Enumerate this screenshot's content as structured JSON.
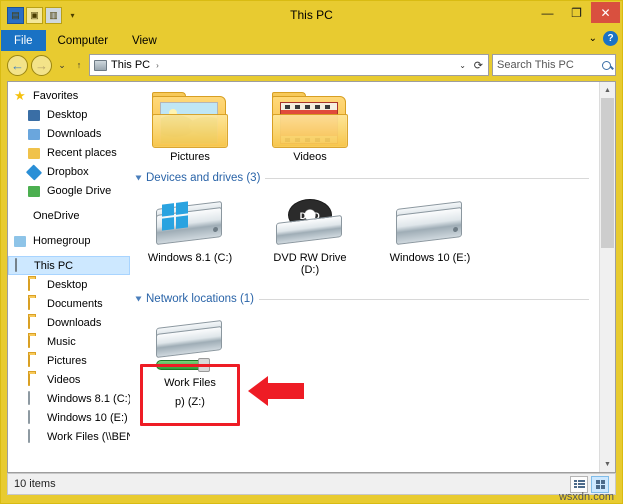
{
  "window": {
    "title": "This PC",
    "minimize": "—",
    "maximize": "❐",
    "close": "✕",
    "quick_access": [
      "window-icon",
      "folder-icon",
      "properties-icon",
      "dropdown-arrow"
    ]
  },
  "ribbon": {
    "tabs": [
      {
        "label": "File",
        "id": "file"
      },
      {
        "label": "Computer",
        "id": "computer"
      },
      {
        "label": "View",
        "id": "view"
      }
    ],
    "collapse": "⌄",
    "help": "?"
  },
  "address_bar": {
    "back": "←",
    "forward": "→",
    "recent": "⌄",
    "up": "↑",
    "path": "This PC",
    "path_separator": "›",
    "dropdown": "⌄",
    "refresh": "⟳",
    "search_placeholder": "Search This PC"
  },
  "sidebar": {
    "items": [
      {
        "label": "Favorites",
        "icon": "star-icon",
        "level": 0
      },
      {
        "label": "Desktop",
        "icon": "desktop-icon",
        "level": 1
      },
      {
        "label": "Downloads",
        "icon": "downloads-icon",
        "level": 1
      },
      {
        "label": "Recent places",
        "icon": "recent-places-icon",
        "level": 1
      },
      {
        "label": "Dropbox",
        "icon": "dropbox-icon",
        "level": 1
      },
      {
        "label": "Google Drive",
        "icon": "google-drive-icon",
        "level": 1
      },
      {
        "label": "OneDrive",
        "icon": "onedrive-icon",
        "level": 0
      },
      {
        "label": "Homegroup",
        "icon": "homegroup-icon",
        "level": 0
      },
      {
        "label": "This PC",
        "icon": "this-pc-icon",
        "level": 0,
        "selected": true
      },
      {
        "label": "Desktop",
        "icon": "folder-icon",
        "level": 1
      },
      {
        "label": "Documents",
        "icon": "folder-icon",
        "level": 1
      },
      {
        "label": "Downloads",
        "icon": "folder-icon",
        "level": 1
      },
      {
        "label": "Music",
        "icon": "folder-icon",
        "level": 1
      },
      {
        "label": "Pictures",
        "icon": "folder-icon",
        "level": 1
      },
      {
        "label": "Videos",
        "icon": "folder-icon",
        "level": 1
      },
      {
        "label": "Windows 8.1 (C:)",
        "icon": "drive-icon",
        "level": 1
      },
      {
        "label": "Windows 10 (E:)",
        "icon": "drive-icon",
        "level": 1
      },
      {
        "label": "Work Files (\\\\BENZ",
        "icon": "network-drive-icon",
        "level": 1
      }
    ]
  },
  "content": {
    "folders_group": {
      "items": [
        {
          "label": "Pictures",
          "icon": "pictures-folder-icon"
        },
        {
          "label": "Videos",
          "icon": "videos-folder-icon"
        }
      ]
    },
    "devices_group": {
      "header": "Devices and drives (3)",
      "items": [
        {
          "label": "Windows 8.1 (C:)",
          "icon": "hard-drive-icon"
        },
        {
          "label": "DVD RW Drive (D:)",
          "icon": "dvd-drive-icon",
          "disc_text": "DVD"
        },
        {
          "label": "Windows 10 (E:)",
          "icon": "hard-drive-icon"
        }
      ]
    },
    "network_group": {
      "header": "Network locations (1)",
      "items": [
        {
          "label": "Work Files",
          "sublabel": "p) (Z:)",
          "icon": "network-drive-icon"
        }
      ]
    }
  },
  "status_bar": {
    "item_count": "10 items",
    "view_details": "details-view-icon",
    "view_large_icons": "large-icons-view-icon"
  },
  "watermark": "wsxdn.com",
  "colors": {
    "window_chrome": "#e8cb30",
    "file_tab": "#1a72c4",
    "close_button": "#d9503f",
    "group_header": "#2a64a8",
    "highlight_red": "#ee1c25",
    "selection_blue": "#cde8ff"
  }
}
